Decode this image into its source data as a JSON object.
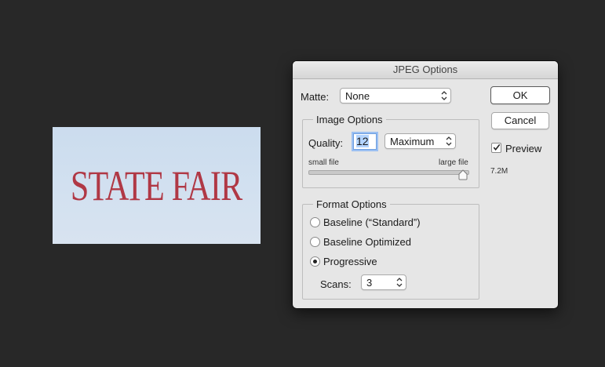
{
  "canvas": {
    "image_text": "STATE FAIR"
  },
  "dialog": {
    "title": "JPEG Options",
    "matte": {
      "label": "Matte:",
      "value": "None"
    },
    "image_options": {
      "title": "Image Options",
      "quality_label": "Quality:",
      "quality_value": "12",
      "quality_preset": "Maximum",
      "small_file_label": "small file",
      "large_file_label": "large file",
      "slider_level": 1.0
    },
    "format_options": {
      "title": "Format Options",
      "options": [
        {
          "label": "Baseline (“Standard”)",
          "selected": false
        },
        {
          "label": "Baseline Optimized",
          "selected": false
        },
        {
          "label": "Progressive",
          "selected": true
        }
      ],
      "scans_label": "Scans:",
      "scans_value": "3"
    },
    "buttons": {
      "ok": "OK",
      "cancel": "Cancel"
    },
    "preview": {
      "label": "Preview",
      "checked": true
    },
    "file_size": "7.2M"
  }
}
